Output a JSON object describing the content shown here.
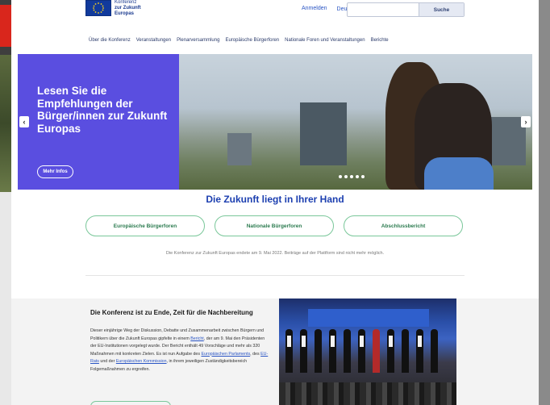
{
  "header": {
    "logo_line1": "Konferenz",
    "logo_line2": "zur Zukunft",
    "logo_line3": "Europas",
    "login_label": "Anmelden",
    "language_label": "Deutsch ▾",
    "search_placeholder": "",
    "search_button": "Suche"
  },
  "nav": {
    "items": [
      "Über die Konferenz",
      "Veranstaltungen",
      "Plenarversammlung",
      "Europäische Bürgerforen",
      "Nationale Foren und Veranstaltungen",
      "Berichte"
    ]
  },
  "hero": {
    "title": "Lesen Sie die Empfehlungen der Bürger/innen zur Zukunft Europas",
    "button_label": "Mehr Infos",
    "prev_arrow": "‹",
    "next_arrow": "›"
  },
  "main": {
    "section_title": "Die Zukunft liegt in Ihrer Hand",
    "buttons": [
      "Europäische Bürgerforen",
      "Nationale Bürgerforen",
      "Abschlussbericht"
    ],
    "info_text": "Die Konferenz zur Zukunft Europas endete am 9. Mai 2022. Beiträge auf der Plattform sind nicht mehr möglich."
  },
  "conclusion": {
    "title": "Die Konferenz ist zu Ende, Zeit für die Nachbereitung",
    "text_1": "Dieser einjährige Weg der Diskussion, Debatte und Zusammenarbeit zwischen Bürgern und Politikern über die Zukunft Europas gipfelte in einem ",
    "link_bericht": "Bericht",
    "text_2": ", der am 9. Mai den Präsidenten der EU-Institutionen vorgelegt wurde. Der Bericht enthält 49 Vorschläge und mehr als 320 Maßnahmen mit konkreten Zielen. Es ist nun Aufgabe des ",
    "link_parliament": "Europäischen Parlaments",
    "text_3": ", des ",
    "link_council": "EU-Rats",
    "text_4": " und der ",
    "link_commission": "Europäischen Kommission",
    "text_5": ", in ihrem jeweiligen Zuständigkeitsbereich Folgemaßnahmen zu ergreifen."
  },
  "colors": {
    "hero_panel": "#5a4ee0",
    "link_blue": "#2a55c4",
    "pill_green": "#7ac79a",
    "title_blue": "#1c3fb0"
  }
}
